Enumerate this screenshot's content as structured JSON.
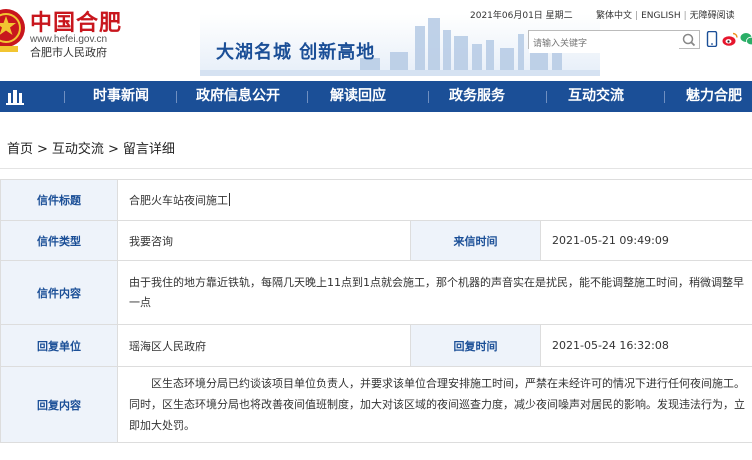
{
  "header": {
    "site_title": "中国合肥",
    "site_url": "www.hefei.gov.cn",
    "site_subtitle": "合肥市人民政府",
    "slogan": "大湖名城  创新高地",
    "date": "2021年06月01日 星期二",
    "links": [
      "繁体中文",
      "ENGLISH",
      "无障碍阅读"
    ],
    "search_placeholder": "请输入关键字"
  },
  "nav": {
    "items": [
      "时事新闻",
      "政府信息公开",
      "解读回应",
      "政务服务",
      "互动交流",
      "魅力合肥"
    ]
  },
  "breadcrumb": {
    "items": [
      "首页",
      "互动交流",
      "留言详细"
    ],
    "separator": ">"
  },
  "detail": {
    "title_label": "信件标题",
    "title_value": "合肥火车站夜间施工",
    "type_label": "信件类型",
    "type_value": "我要咨询",
    "sent_label": "来信时间",
    "sent_value": "2021-05-21 09:49:09",
    "content_label": "信件内容",
    "content_value": "由于我住的地方靠近铁轨，每隔几天晚上11点到1点就会施工，那个机器的声音实在是扰民，能不能调整施工时间，稍微调整早一点",
    "unit_label": "回复单位",
    "unit_value": "瑶海区人民政府",
    "reply_time_label": "回复时间",
    "reply_time_value": "2021-05-24 16:32:08",
    "reply_label": "回复内容",
    "reply_value": "区生态环境分局已约谈该项目单位负责人，并要求该单位合理安排施工时间，严禁在未经许可的情况下进行任何夜间施工。同时，区生态环境分局也将改善夜间值班制度，加大对该区域的夜间巡查力度，减少夜间噪声对居民的影响。发现违法行为，立即加大处罚。"
  },
  "colors": {
    "brand_red": "#c8161d",
    "nav_blue": "#1b4f97",
    "label_bg": "#eef3fa"
  }
}
